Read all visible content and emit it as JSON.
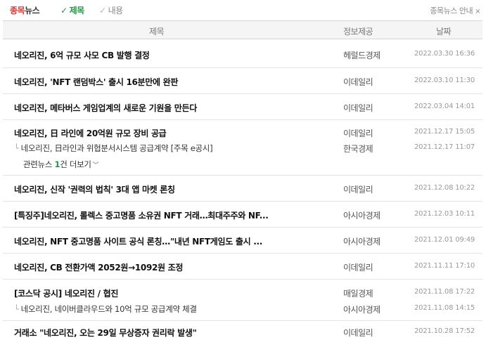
{
  "topbar": {
    "brand_part1": "종목",
    "brand_part2": "뉴스",
    "tab_title": "제목",
    "tab_content": "내용",
    "guide_label": "종목뉴스 안내",
    "guide_close": "×"
  },
  "header": {
    "title_col": "제목",
    "source_col": "정보제공",
    "date_col": "날짜"
  },
  "articles": [
    {
      "title": "네오리진, 6억 규모 사모 CB 발행 결정",
      "source": "헤럴드경제",
      "date": "2022.03.30 16:36"
    },
    {
      "title": "네오리진, 'NFT 랜덤박스' 출시 16분만에 완판",
      "source": "이데일리",
      "date": "2022.03.10 11:30"
    },
    {
      "title": "네오리진, 메타버스 게임업계의 새로운 기원을 만든다",
      "source": "이데일리",
      "date": "2022.03.04 14:01"
    },
    {
      "title": "네오리진, 日 라인에 20억원 규모 장비 공급",
      "source": "이데일리",
      "date": "2021.12.17 15:05",
      "sub_title": "네오리진, 日라인과 위협분서시스템 공급계약 [주목 e공시]",
      "sub_source": "한국경제",
      "sub_date": "2021.12.17 11:07",
      "related_prefix": "관련뉴스 ",
      "related_count": "1",
      "related_suffix": "건 더보기"
    },
    {
      "title": "네오리진, 신작 '권력의 법칙' 3대 앱 마켓 론칭",
      "source": "이데일리",
      "date": "2021.12.08 10:22"
    },
    {
      "title": "[특징주]네오리진, 롤렉스 중고명품 소유권 NFT 거래…최대주주와 NF...",
      "source": "아시아경제",
      "date": "2021.12.03 10:11"
    },
    {
      "title": "네오리진, NFT 중고명품 사이트 공식 론칭…\"내년 NFT게임도 출시 ...",
      "source": "아시아경제",
      "date": "2021.12.01 09:49"
    },
    {
      "title": "네오리진, CB 전환가액 2052원→1092원 조정",
      "source": "이데일리",
      "date": "2021.11.11 17:10"
    },
    {
      "title": "[코스닥 공시] 네오리진 / 협진",
      "source": "매일경제",
      "date": "2021.11.08 17:22",
      "sub_title": "네오리진, 네이버클라우드와 10억 규모 공급계약 체결",
      "sub_source": "아시아경제",
      "sub_date": "2021.11.08 14:15"
    },
    {
      "title": "거래소 \"네오리진, 오는 29일 무상증자 권리락 발생\"",
      "source": "이데일리",
      "date": "2021.10.28 17:52"
    }
  ]
}
